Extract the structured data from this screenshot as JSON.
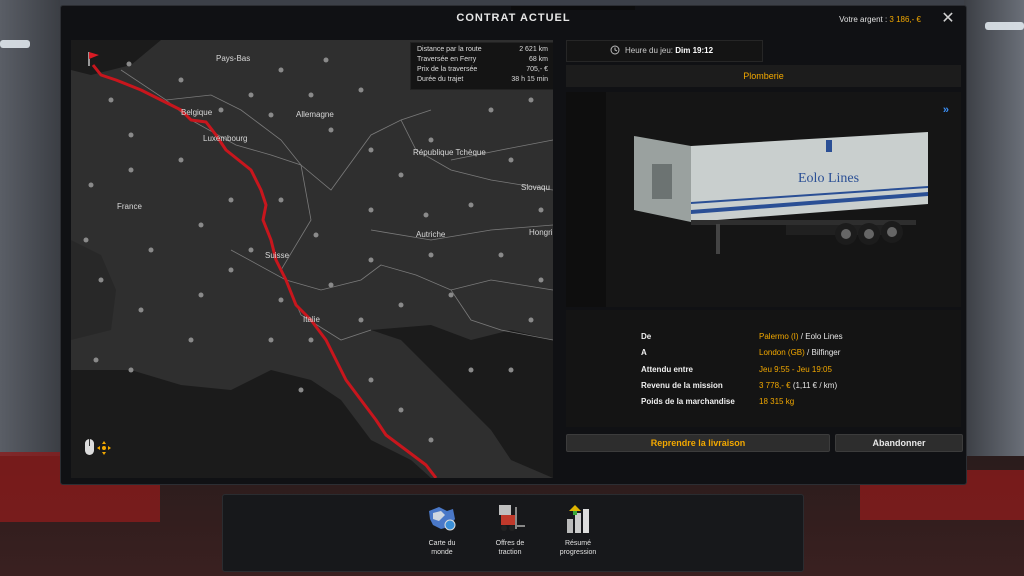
{
  "window": {
    "title": "CONTRAT ACTUEL",
    "money_label": "Votre argent :",
    "money_value": "3 186,- €",
    "close_icon": "close-icon"
  },
  "route_info": {
    "rows": [
      {
        "label": "Distance par la route",
        "value": "2 621 km"
      },
      {
        "label": "Traversée en Ferry",
        "value": "68 km"
      },
      {
        "label": "Prix de la traversée",
        "value": "705,- €"
      },
      {
        "label": "Durée du trajet",
        "value": "38 h 15 min"
      }
    ]
  },
  "map": {
    "labels": {
      "pays_bas": "Pays-Bas",
      "belgique": "Belgique",
      "allemagne": "Allemagne",
      "luxembourg": "Luxembourg",
      "republique_tcheque": "République Tchèque",
      "slovaquie": "Slovaqu",
      "france": "France",
      "autriche": "Autriche",
      "hongrie": "Hongrie",
      "suisse": "Suisse",
      "italie": "Italie"
    },
    "route_color": "#c8161d"
  },
  "game_time": {
    "label": "Heure du jeu:",
    "value": "Dim 19:12"
  },
  "cargo": {
    "name": "Plomberie",
    "trailer_brand": "Eolo Lines"
  },
  "details": {
    "from_label": "De",
    "from_city": "Palermo (I)",
    "from_company": "Eolo Lines",
    "to_label": "A",
    "to_city": "London (GB)",
    "to_company": "Bilfinger",
    "expected_label": "Attendu entre",
    "expected_value": "Jeu 9:55 - Jeu 19:05",
    "revenue_label": "Revenu de la mission",
    "revenue_value": "3 778,- €",
    "revenue_rate": "(1,11 € / km)",
    "weight_label": "Poids de la marchandise",
    "weight_value": "18 315 kg"
  },
  "buttons": {
    "resume": "Reprendre la livraison",
    "abandon": "Abandonner"
  },
  "dock": {
    "items": [
      {
        "label1": "Carte du",
        "label2": "monde",
        "icon": "world-map-icon"
      },
      {
        "label1": "Offres de",
        "label2": "traction",
        "icon": "forklift-icon"
      },
      {
        "label1": "Résumé",
        "label2": "progression",
        "icon": "progress-summary-icon"
      }
    ]
  },
  "colors": {
    "accent": "#f2a800",
    "link_blue": "#3b8ff5"
  }
}
